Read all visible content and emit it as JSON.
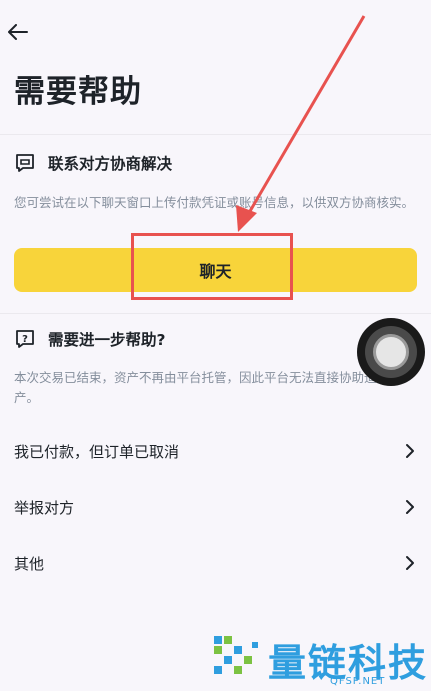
{
  "page": {
    "title": "需要帮助"
  },
  "negotiate": {
    "heading": "联系对方协商解决",
    "description": "您可尝试在以下聊天窗口上传付款凭证或账号信息，以供双方协商核实。",
    "chat_button": "聊天"
  },
  "more_help": {
    "heading": "需要进一步帮助?",
    "description": "本次交易已结束，资产不再由平台托管，因此平台无法直接协助追回资产。",
    "items": [
      {
        "label": "我已付款，但订单已取消"
      },
      {
        "label": "举报对方"
      },
      {
        "label": "其他"
      }
    ]
  },
  "watermark": {
    "text": "量链科技",
    "sub": "QFSP.NET"
  },
  "colors": {
    "accent": "#f8d43a",
    "highlight": "#e8524f",
    "watermark": "#2f9edf"
  }
}
